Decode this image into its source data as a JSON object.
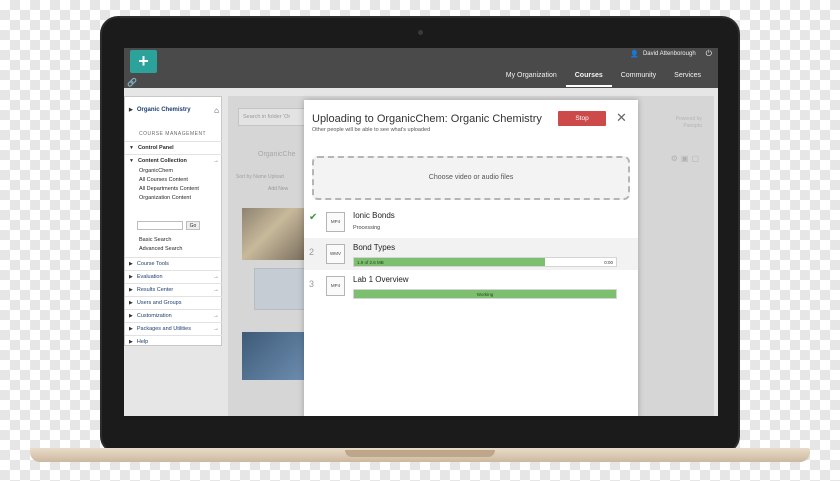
{
  "header": {
    "user_name": "David Attenborough",
    "nav": [
      "My Organization",
      "Courses",
      "Community",
      "Services"
    ],
    "active_nav": "Courses"
  },
  "sidebar": {
    "course_title": "Organic Chemistry",
    "management_label": "COURSE MANAGEMENT",
    "control_panel": "Control Panel",
    "content_collection": "Content Collection",
    "links": [
      "OrganicChem",
      "All Courses Content",
      "All Departments Content",
      "Organization Content"
    ],
    "go_label": "Go",
    "basic_search": "Basic Search",
    "advanced_search": "Advanced Search",
    "tools": [
      "Course Tools",
      "Evaluation",
      "Results Center",
      "Users and Groups",
      "Customization",
      "Packages and Utilities",
      "Help"
    ]
  },
  "background": {
    "search_placeholder": "Search in folder 'Or",
    "breadcrumb": "OrganicChe",
    "sort_row": "Sort by   Name   Upload",
    "add_new": "Add New",
    "powered_by": "Powered by\nPanopto"
  },
  "modal": {
    "title": "Uploading to OrganicChem: Organic Chemistry",
    "subtitle": "Other people will be able to see what's uploaded",
    "stop_label": "Stop",
    "close_glyph": "✕",
    "drop_zone": "Choose video or audio files",
    "uploads": [
      {
        "marker": "✔",
        "type": "MP4",
        "name": "Ionic Bonds",
        "status": "Processing"
      },
      {
        "marker": "2",
        "type": "WMV",
        "name": "Bond Types",
        "progress_text": "1.9 of 2.6 MB",
        "time": "0:00",
        "progress": 0.73
      },
      {
        "marker": "3",
        "type": "MP4",
        "name": "Lab 1 Overview",
        "status": "Working",
        "progress": 1.0
      }
    ]
  },
  "colors": {
    "brand": "#2ba39a",
    "stop": "#cc4a4a",
    "progress": "#7cbf6f",
    "header": "#4a4a4a"
  },
  "icons": [
    "plus-icon",
    "link-icon",
    "user-icon",
    "power-icon",
    "home-icon",
    "check-icon",
    "close-icon",
    "rss-icon",
    "gear-icon"
  ]
}
